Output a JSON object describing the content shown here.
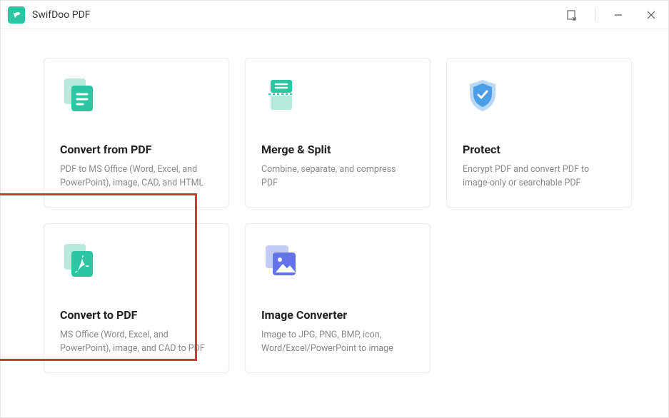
{
  "app": {
    "title": "SwifDoo PDF"
  },
  "cards": [
    {
      "title": "Convert from PDF",
      "desc": "PDF to MS Office (Word, Excel, and PowerPoint), image, CAD, and HTML"
    },
    {
      "title": "Merge & Split",
      "desc": "Combine, separate, and compress PDF"
    },
    {
      "title": "Protect",
      "desc": "Encrypt PDF and convert PDF to image-only or searchable PDF"
    },
    {
      "title": "Convert to PDF",
      "desc": "MS Office (Word, Excel, and PowerPoint), image, and CAD to PDF"
    },
    {
      "title": "Image Converter",
      "desc": "Image to JPG, PNG, BMP, icon, Word/Excel/PowerPoint to image"
    }
  ],
  "highlight": {
    "card_index": 3
  }
}
